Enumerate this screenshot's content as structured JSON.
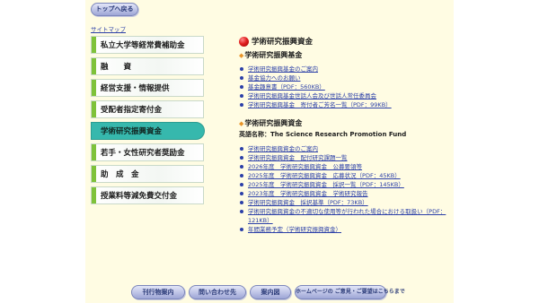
{
  "nav": {
    "top_button": "トップへ戻る",
    "sitemap": "サイトマップ"
  },
  "menu": [
    {
      "label": "私立大学等経常費補助金"
    },
    {
      "label": "融　　資"
    },
    {
      "label": "経営支援・情報提供"
    },
    {
      "label": "受配者指定寄付金"
    },
    {
      "label": "学術研究振興資金"
    },
    {
      "label": "若手・女性研究者奨励金"
    },
    {
      "label": "助　成　金"
    },
    {
      "label": "授業料等減免費交付金"
    }
  ],
  "content": {
    "title": "学術研究振興資金",
    "section1": {
      "heading": "学術研究振興基金",
      "links": [
        "学術研究振興基金のご案内",
        "基金協力へのお願い",
        "基金趣意書（PDF：560KB）",
        "学術研究振興基金世話人会及び世話人常任委員会",
        "学術研究振興基金　寄付者ご芳名一覧（PDF：99KB）"
      ]
    },
    "section2": {
      "heading": "学術研究振興資金",
      "english_label": "英語名称：",
      "english_name": "The Science Research Promotion Fund",
      "links": [
        "学術研究振興資金のご案内",
        "学術研究振興資金　配付研究課題一覧",
        "2026年度　学術研究振興資金　公募要領等",
        "2025年度　学術研究振興資金　応募状況（PDF：45KB）",
        "2025年度　学術研究振興資金　採択一覧（PDF：145KB）",
        "2023年度　学術研究振興資金　学術研究報告",
        "学術研究振興資金　採択基準（PDF：73KB）",
        "学術研究振興資金の不適切な使用等が行われた場合における取扱い（PDF：121KB）",
        "年間業務予定（学術研究振興資金）"
      ]
    }
  },
  "footer": {
    "buttons": [
      "刊行物案内",
      "問い合わせ先",
      "案内図",
      "ホームページの ご意見・ご要望はこちらまで"
    ]
  }
}
